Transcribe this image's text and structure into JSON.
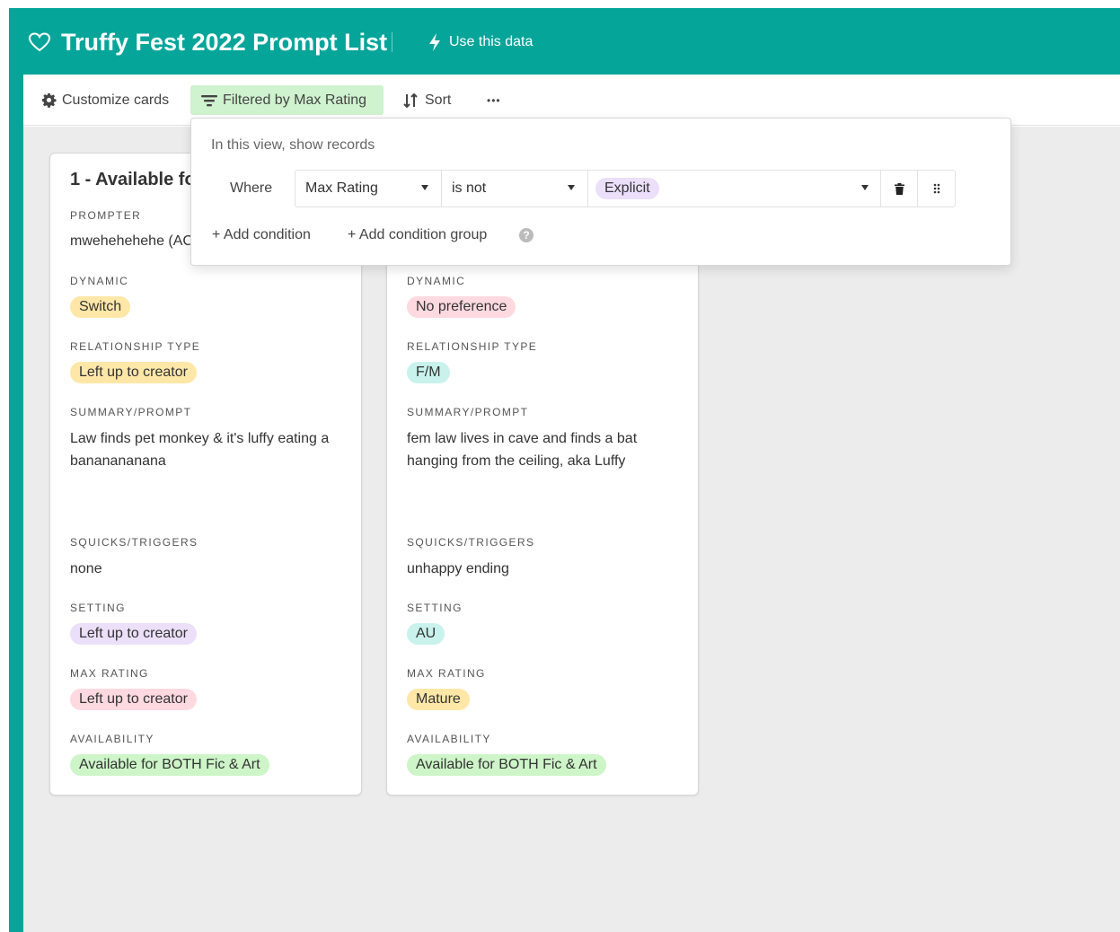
{
  "header": {
    "title": "Truffy Fest 2022 Prompt List",
    "use_data_label": "Use this data",
    "brand_color": "#06a59a"
  },
  "toolbar": {
    "customize_label": "Customize cards",
    "filtered_label": "Filtered by Max Rating",
    "sort_label": "Sort",
    "more_label": "•••"
  },
  "filter_popover": {
    "title": "In this view, show records",
    "where_label": "Where",
    "condition": {
      "field": "Max Rating",
      "operator": "is not",
      "value": "Explicit"
    },
    "add_condition_label": "+ Add condition",
    "add_group_label": "+ Add condition group",
    "help_glyph": "?"
  },
  "cards": [
    {
      "title": "1 - Available fo",
      "prompter_label": "PROMPTER",
      "prompter": "mwehehehehe (AC",
      "dynamic_label": "DYNAMIC",
      "dynamic": "Switch",
      "relationship_label": "RELATIONSHIP TYPE",
      "relationship": "Left up to creator",
      "summary_label": "SUMMARY/PROMPT",
      "summary": "Law finds pet monkey & it's luffy eating a bananananana",
      "squicks_label": "SQUICKS/TRIGGERS",
      "squicks": "none",
      "setting_label": "SETTING",
      "setting": "Left up to creator",
      "rating_label": "MAX RATING",
      "rating": "Left up to creator",
      "availability_label": "AVAILABILITY",
      "availability": "Available for BOTH Fic & Art"
    },
    {
      "dynamic_label": "DYNAMIC",
      "dynamic": "No preference",
      "relationship_label": "RELATIONSHIP TYPE",
      "relationship": "F/M",
      "summary_label": "SUMMARY/PROMPT",
      "summary": "fem law lives in cave and finds a bat hanging from the ceiling, aka Luffy",
      "squicks_label": "SQUICKS/TRIGGERS",
      "squicks": "unhappy ending",
      "setting_label": "SETTING",
      "setting": "AU",
      "rating_label": "MAX RATING",
      "rating": "Mature",
      "availability_label": "AVAILABILITY",
      "availability": "Available for BOTH Fic & Art"
    }
  ]
}
